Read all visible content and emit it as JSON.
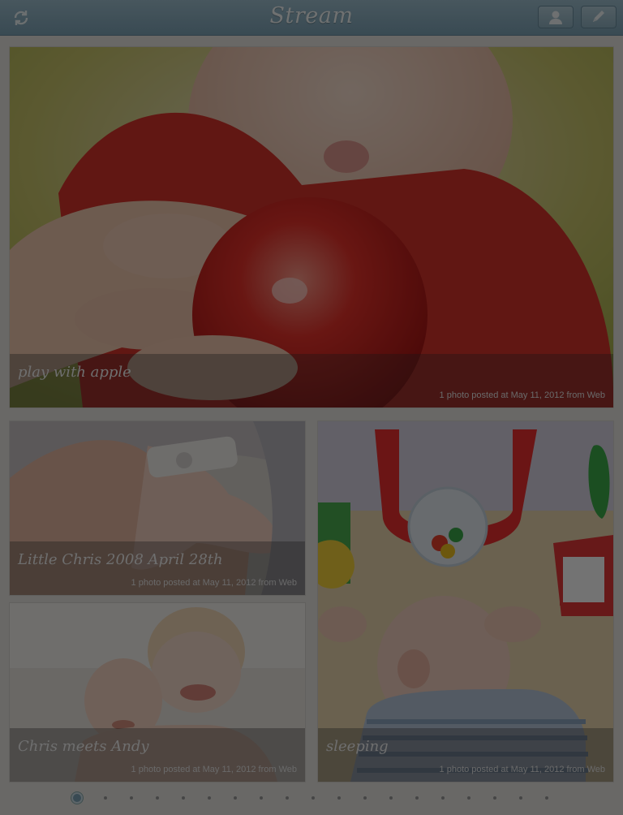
{
  "header": {
    "title": "Stream",
    "refresh_icon": "refresh-icon",
    "profile_icon": "person-icon",
    "compose_icon": "pencil-icon",
    "bar_color": "#8fb1c2"
  },
  "cards": [
    {
      "title": "play with apple",
      "meta": "1 photo posted at May 11, 2012 from Web"
    },
    {
      "title": "Little Chris 2008 April 28th",
      "meta": "1 photo posted at May 11, 2012 from Web"
    },
    {
      "title": "Chris meets Andy",
      "meta": "1 photo posted at May 11, 2012 from Web"
    },
    {
      "title": "sleeping",
      "meta": "1 photo posted at May 11, 2012 from Web"
    }
  ],
  "pager": {
    "total": 19,
    "current": 1
  },
  "overlay": {
    "dimmed": true,
    "color": "#000000",
    "opacity": 0.55
  }
}
